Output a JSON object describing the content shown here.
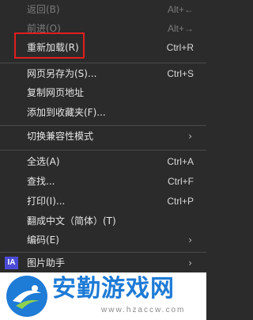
{
  "menu": {
    "items": [
      {
        "label": "返回(B)",
        "shortcut": "Alt+←",
        "disabled": true
      },
      {
        "label": "前进(O)",
        "shortcut": "Alt+→",
        "disabled": true
      },
      {
        "label": "重新加载(R)",
        "shortcut": "Ctrl+R",
        "disabled": false
      },
      {
        "label": "网页另存为(S)...",
        "shortcut": "Ctrl+S",
        "disabled": false
      },
      {
        "label": "复制网页地址",
        "shortcut": "",
        "disabled": false
      },
      {
        "label": "添加到收藏夹(F)...",
        "shortcut": "",
        "disabled": false
      },
      {
        "label": "切换兼容性模式",
        "submenu": true,
        "disabled": false
      },
      {
        "label": "全选(A)",
        "shortcut": "Ctrl+A",
        "disabled": false
      },
      {
        "label": "查找...",
        "shortcut": "Ctrl+F",
        "disabled": false
      },
      {
        "label": "打印(I)...",
        "shortcut": "Ctrl+P",
        "disabled": false
      },
      {
        "label": "翻成中文（简体）(T)",
        "shortcut": "",
        "disabled": false
      },
      {
        "label": "编码(E)",
        "submenu": true,
        "disabled": false
      },
      {
        "label": "图片助手",
        "submenu": true,
        "icon_text": "IA",
        "disabled": false
      }
    ],
    "submenu_arrow": "›"
  },
  "highlight": {
    "color": "#e01e1e",
    "target": "重新加载(R)"
  },
  "watermark": {
    "title": "安勤游戏网",
    "url": "www.hzaccw.com",
    "color": "#1e7bd6"
  },
  "colors": {
    "background": "#2b2b2b",
    "text": "#e6e6e6",
    "disabled_text": "#7a7a7a",
    "separator": "#4a4a4a",
    "icon_bg": "#4b4bd6"
  }
}
